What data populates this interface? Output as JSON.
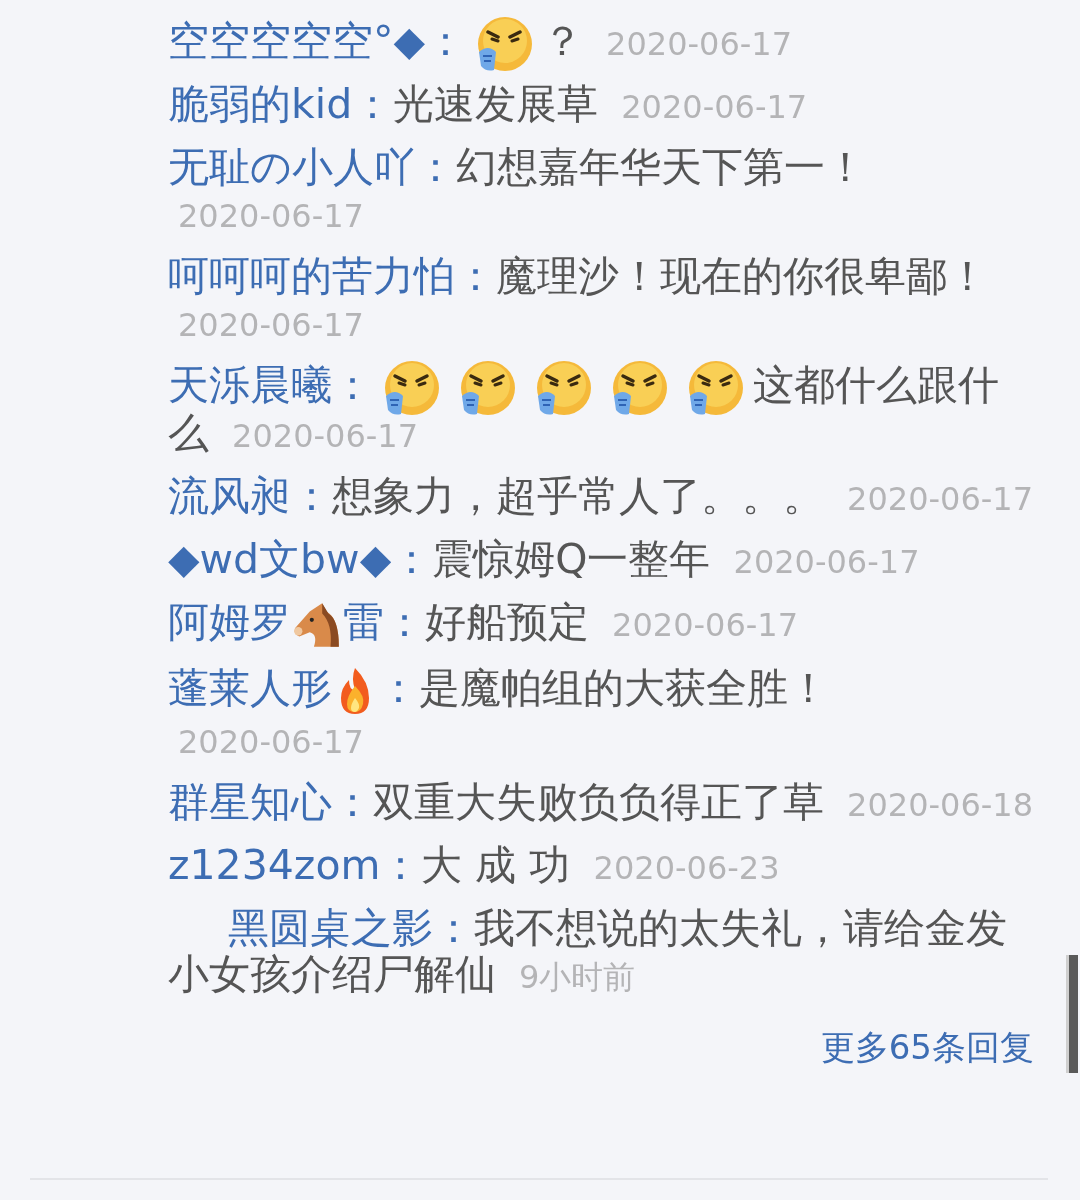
{
  "replies": [
    {
      "user": [
        {
          "kind": "text",
          "text": "空空空空空°◆"
        },
        {
          "kind": "text",
          "text": "："
        }
      ],
      "body": [
        {
          "kind": "angry"
        },
        {
          "kind": "text",
          "text": "？"
        }
      ],
      "time": "2020-06-17"
    },
    {
      "user": [
        {
          "kind": "text",
          "text": "脆弱的kid："
        }
      ],
      "body": [
        {
          "kind": "text",
          "text": "光速发展草"
        }
      ],
      "time": "2020-06-17"
    },
    {
      "user": [
        {
          "kind": "text",
          "text": "无耻の小人吖："
        }
      ],
      "body": [
        {
          "kind": "text",
          "text": "幻想嘉年华天下第一！"
        }
      ],
      "time": "2020-06-17"
    },
    {
      "user": [
        {
          "kind": "text",
          "text": "呵呵呵的苦力怕："
        }
      ],
      "body": [
        {
          "kind": "text",
          "text": "魔理沙！现在的你很卑鄙！"
        }
      ],
      "time": "2020-06-17"
    },
    {
      "user": [
        {
          "kind": "text",
          "text": "天泺晨曦："
        }
      ],
      "body": [
        {
          "kind": "angry"
        },
        {
          "kind": "angry"
        },
        {
          "kind": "angry"
        },
        {
          "kind": "angry"
        },
        {
          "kind": "angry"
        },
        {
          "kind": "text",
          "text": "这都什么跟什"
        },
        {
          "kind": "text",
          "text": "么"
        }
      ],
      "time": "2020-06-17"
    },
    {
      "user": [
        {
          "kind": "text",
          "text": "流风昶："
        }
      ],
      "body": [
        {
          "kind": "text",
          "text": "想象力，超乎常人了。。。"
        }
      ],
      "time": "2020-06-17"
    },
    {
      "user": [
        {
          "kind": "text",
          "text": "◆wd文bw◆："
        }
      ],
      "body": [
        {
          "kind": "text",
          "text": "震惊姆Q一整年"
        }
      ],
      "time": "2020-06-17"
    },
    {
      "user": [
        {
          "kind": "text",
          "text": "阿姆罗"
        },
        {
          "kind": "horse"
        },
        {
          "kind": "text",
          "text": "雷："
        }
      ],
      "body": [
        {
          "kind": "text",
          "text": "好船预定"
        }
      ],
      "time": "2020-06-17"
    },
    {
      "user": [
        {
          "kind": "text",
          "text": "蓬莱人形"
        },
        {
          "kind": "fire"
        },
        {
          "kind": "text",
          "text": "："
        }
      ],
      "body": [
        {
          "kind": "text",
          "text": "是魔帕组的大获全胜！"
        }
      ],
      "time": "2020-06-17"
    },
    {
      "user": [
        {
          "kind": "text",
          "text": "群星知心："
        }
      ],
      "body": [
        {
          "kind": "text",
          "text": "双重大失败负负得正了草"
        }
      ],
      "time": "2020-06-18"
    },
    {
      "user": [
        {
          "kind": "text",
          "text": "z1234zom："
        }
      ],
      "body": [
        {
          "kind": "text",
          "text": "大 成 功"
        }
      ],
      "time": "2020-06-23"
    },
    {
      "user": [
        {
          "kind": "text",
          "text": "黑圆桌之影："
        }
      ],
      "body": [
        {
          "kind": "text",
          "text": "我不想说的太失礼，请给金发"
        },
        {
          "kind": "text",
          "text": "小女孩介绍尸解仙"
        }
      ],
      "time": "9小时前"
    }
  ],
  "more_link": "更多65条回复"
}
